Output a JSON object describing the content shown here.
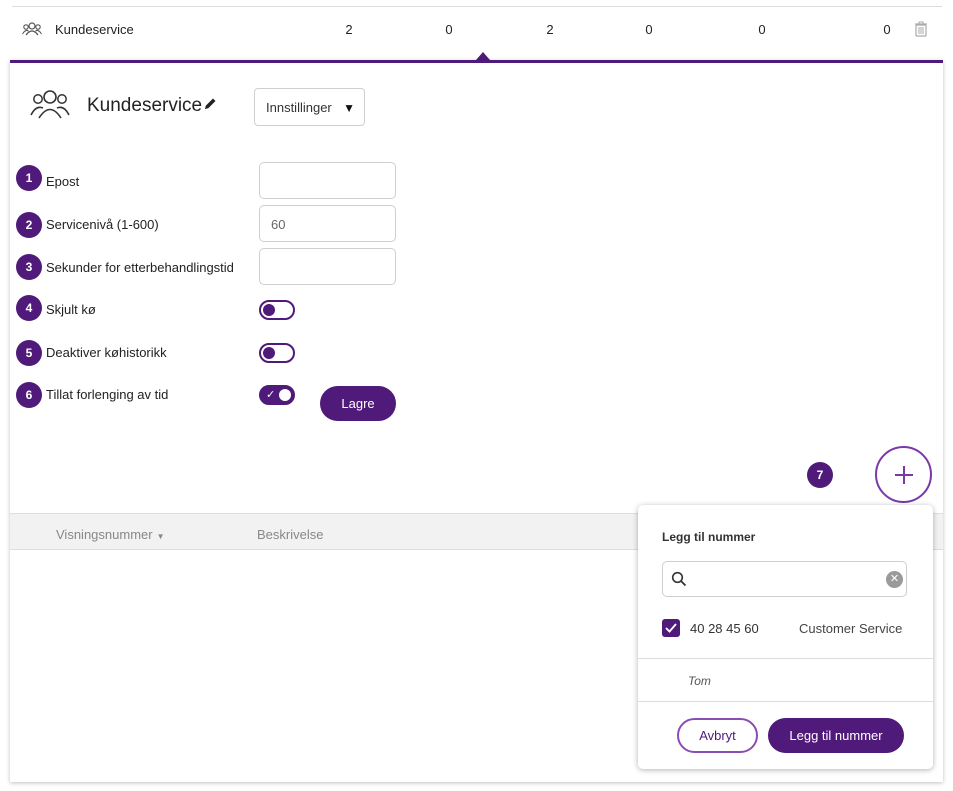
{
  "queue_row": {
    "name": "Kundeservice",
    "stats": [
      "2",
      "0",
      "2",
      "0",
      "0",
      "0"
    ]
  },
  "panel": {
    "title": "Kundeservice",
    "settings_select": "Innstillinger",
    "form": [
      {
        "badge": "1",
        "label": "Epost",
        "type": "text",
        "value": ""
      },
      {
        "badge": "2",
        "label": "Servicenivå (1-600)",
        "type": "text",
        "value": "60"
      },
      {
        "badge": "3",
        "label": "Sekunder for etterbehandlingstid",
        "type": "text",
        "value": ""
      },
      {
        "badge": "4",
        "label": "Skjult kø",
        "type": "toggle",
        "on": false
      },
      {
        "badge": "5",
        "label": "Deaktiver køhistorikk",
        "type": "toggle",
        "on": false
      },
      {
        "badge": "6",
        "label": "Tillat forlenging av tid",
        "type": "toggle",
        "on": true
      }
    ],
    "save_label": "Lagre",
    "add_badge": "7",
    "table_headers": [
      "Visningsnummer",
      "Beskrivelse"
    ]
  },
  "popup": {
    "title": "Legg til nummer",
    "search_value": "",
    "items": [
      {
        "number": "40 28 45 60",
        "description": "Customer Service",
        "checked": true
      }
    ],
    "empty_text": "Tom",
    "cancel_label": "Avbryt",
    "confirm_label": "Legg til nummer"
  },
  "colors": {
    "accent": "#4f1a7a",
    "accent_light": "#7a39a8"
  },
  "icons": [
    "users-icon",
    "trash-icon",
    "pencil-icon",
    "chevron-down-icon",
    "plus-icon",
    "search-icon",
    "clear-icon",
    "checkbox-check-icon"
  ]
}
